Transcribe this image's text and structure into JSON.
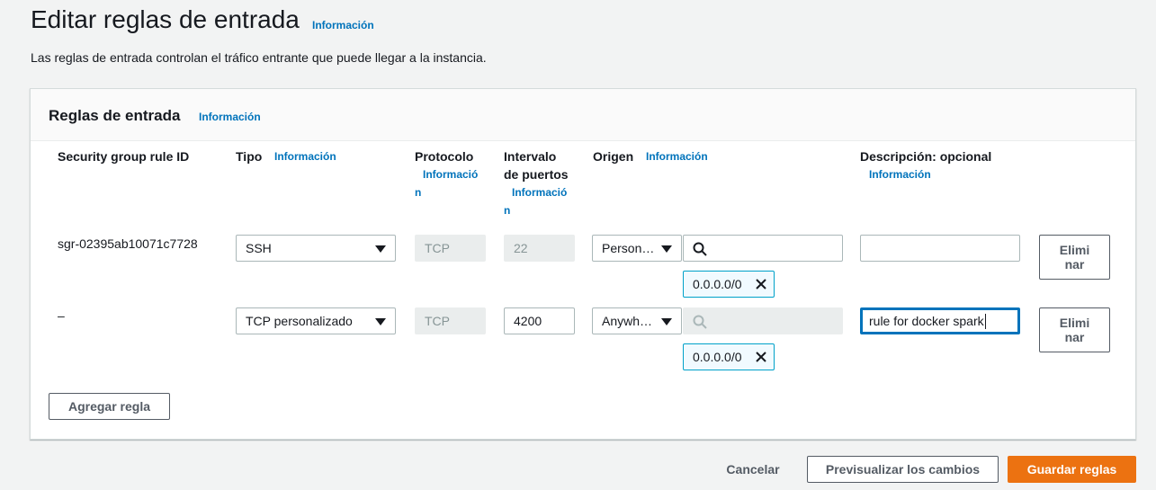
{
  "header": {
    "title": "Editar reglas de entrada",
    "info": "Información",
    "subtitle": "Las reglas de entrada controlan el tráfico entrante que puede llegar a la instancia."
  },
  "panel": {
    "title": "Reglas de entrada",
    "info": "Información"
  },
  "columns": {
    "rule_id": "Security group rule ID",
    "type": "Tipo",
    "type_info": "Información",
    "protocol": "Protocolo",
    "protocol_info_1": "Informació",
    "protocol_info_2": "n",
    "port_1": "Intervalo",
    "port_2": "de puertos",
    "port_info_1": "Informació",
    "port_info_2": "n",
    "source": "Origen",
    "source_info": "Información",
    "description": "Descripción: opcional",
    "description_info": "Información"
  },
  "rules": [
    {
      "rule_id": "sgr-02395ab10071c7728",
      "type": "SSH",
      "protocol": "TCP",
      "port": "22",
      "source_type": "Person…",
      "source_search": "",
      "cidr": "0.0.0.0/0",
      "description": "",
      "delete_1": "Elimi",
      "delete_2": "nar"
    },
    {
      "rule_id": "–",
      "type": "TCP personalizado",
      "protocol": "TCP",
      "port": "4200",
      "source_type": "Anywh…",
      "source_search": "",
      "cidr": "0.0.0.0/0",
      "description": "rule for docker spark",
      "delete_1": "Elimi",
      "delete_2": "nar"
    }
  ],
  "add_rule": "Agregar regla",
  "footer": {
    "cancel": "Cancelar",
    "preview": "Previsualizar los cambios",
    "save": "Guardar reglas"
  },
  "colors": {
    "link": "#0073bb",
    "primary": "#ec7211",
    "token_border": "#00a1c9"
  },
  "icons": {
    "search": "search-icon",
    "dropdown": "chevron-down-icon",
    "remove_token": "close-icon"
  }
}
